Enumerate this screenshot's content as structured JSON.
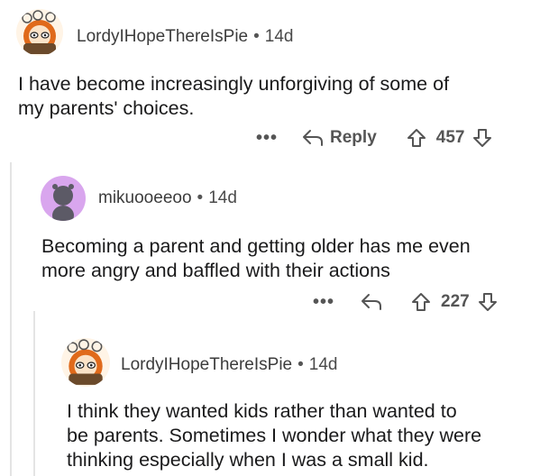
{
  "comments": [
    {
      "username": "LordyIHopeThereIsPie",
      "age": "14d",
      "text_lines": [
        "I have become increasingly unforgiving of some of",
        "my parents' choices."
      ],
      "more": "•••",
      "reply_label": "Reply",
      "score": "457",
      "avatar_icon": "snoo-custom-avatar-icon"
    },
    {
      "username": "mikuooeeoo",
      "age": "14d",
      "text_lines": [
        "Becoming a parent and getting older has me even",
        "more angry and baffled with their actions"
      ],
      "more": "•••",
      "score": "227",
      "avatar_icon": "snoo-default-avatar-icon"
    },
    {
      "username": "LordyIHopeThereIsPie",
      "age": "14d",
      "text_lines": [
        "I think they wanted kids rather than wanted to",
        "be parents. Sometimes I wonder what they were",
        "thinking especially when I was a small kid."
      ],
      "avatar_icon": "snoo-custom-avatar-icon"
    }
  ],
  "separator": "•",
  "colors": {
    "text": "#1a1a1b",
    "meta": "#4a4a4a",
    "thread_line": "#e4e4e4",
    "default_avatar_bg": "#d9a6ee"
  }
}
